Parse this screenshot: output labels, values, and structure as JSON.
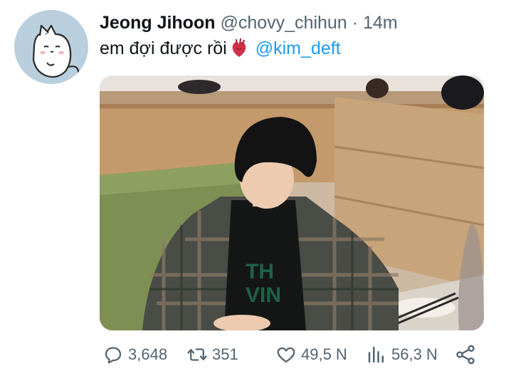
{
  "tweet": {
    "author": {
      "display_name": "Jeong Jihoon",
      "handle": "@chovy_chihun",
      "separator": "·",
      "time": "14m",
      "avatar_icon": "cat-avatar-icon"
    },
    "text": "em đợi được rồi",
    "emoji": "anatomical-heart-icon",
    "mention": "@kim_deft",
    "colors": {
      "mention": "#1d9bf0",
      "secondary_text": "#536471",
      "avatar_bg": "#b9cfde"
    },
    "actions": {
      "replies": "3,648",
      "retweets": "351",
      "likes": "49,5 N",
      "views": "56,3 N"
    }
  }
}
